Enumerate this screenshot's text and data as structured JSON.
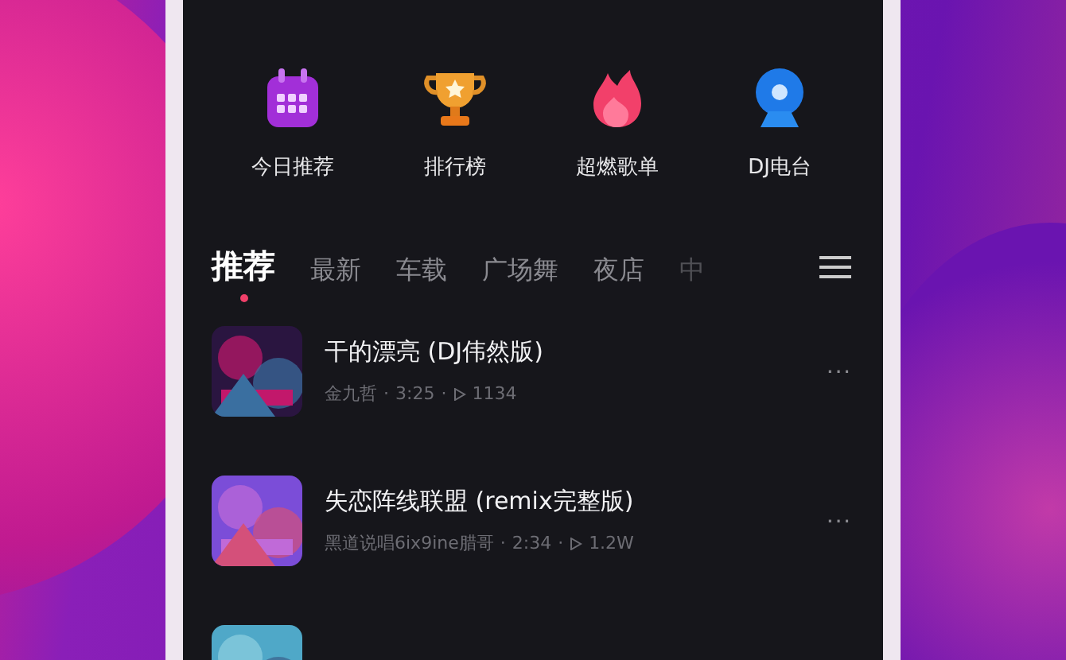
{
  "shortcuts": [
    {
      "label": "今日推荐",
      "kind": "calendar"
    },
    {
      "label": "排行榜",
      "kind": "trophy"
    },
    {
      "label": "超燃歌单",
      "kind": "flame"
    },
    {
      "label": "DJ电台",
      "kind": "radio"
    }
  ],
  "separator": "·",
  "tabs": [
    {
      "label": "推荐",
      "selected": true
    },
    {
      "label": "最新",
      "selected": false
    },
    {
      "label": "车载",
      "selected": false
    },
    {
      "label": "广场舞",
      "selected": false
    },
    {
      "label": "夜店",
      "selected": false
    },
    {
      "label": "中",
      "selected": false
    }
  ],
  "songs": [
    {
      "title": "干的漂亮 (DJ伟然版)",
      "artist": "金九哲",
      "duration": "3:25",
      "plays": "1134",
      "more": "···"
    },
    {
      "title": "失恋阵线联盟 (remix完整版)",
      "artist": "黑道说唱6ix9ine腊哥",
      "duration": "2:34",
      "plays": "1.2W",
      "more": "···"
    },
    {
      "kind": "picture"
    }
  ]
}
